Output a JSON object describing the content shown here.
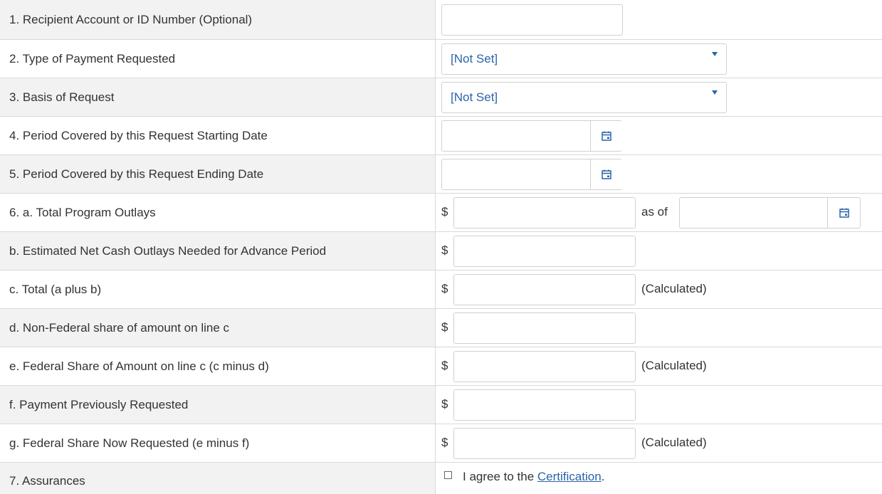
{
  "rows": [
    {
      "label": "1. Recipient Account or ID Number (Optional)"
    },
    {
      "label": "2. Type of Payment Requested",
      "select_value": "[Not Set]"
    },
    {
      "label": "3. Basis of Request",
      "select_value": "[Not Set]"
    },
    {
      "label": "4. Period Covered by this Request Starting Date"
    },
    {
      "label": "5. Period Covered by this Request Ending Date"
    },
    {
      "label": "6. a. Total Program Outlays",
      "currency": "$",
      "as_of": "as of"
    },
    {
      "label": "b. Estimated Net Cash Outlays Needed for Advance Period",
      "currency": "$"
    },
    {
      "label": "c. Total (a plus b)",
      "currency": "$",
      "note": "(Calculated)"
    },
    {
      "label": "d. Non-Federal share of amount on line c",
      "currency": "$"
    },
    {
      "label": "e. Federal Share of Amount on line c (c minus d)",
      "currency": "$",
      "note": "(Calculated)"
    },
    {
      "label": "f. Payment Previously Requested",
      "currency": "$"
    },
    {
      "label": "g. Federal Share Now Requested (e minus f)",
      "currency": "$",
      "note": "(Calculated)"
    },
    {
      "label": "7. Assurances",
      "agree_prefix": "I agree to the ",
      "agree_link": "Certification",
      "agree_suffix": "."
    }
  ],
  "colors": {
    "label_bg": "#f2f2f2",
    "link": "#2a64a8",
    "border": "#d9d9d9"
  },
  "icons": {
    "calendar": "calendar-icon",
    "dropdown": "chevron-down-icon",
    "checkbox": "checkbox-unchecked"
  }
}
